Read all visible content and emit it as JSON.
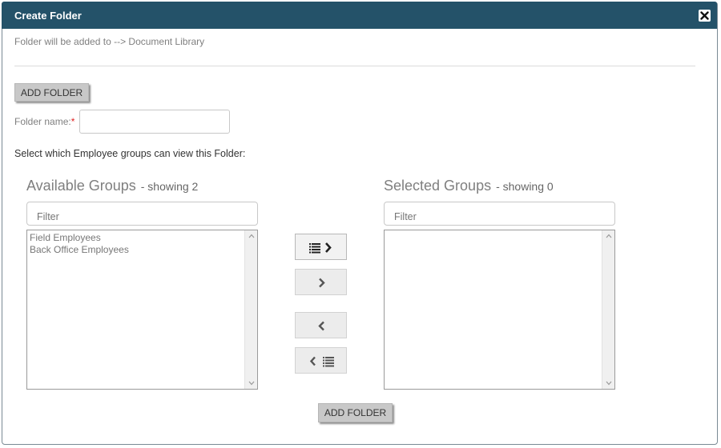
{
  "dialog": {
    "title": "Create Folder",
    "subtitle": "Folder will be added to --> Document Library"
  },
  "icons": {
    "close": "close-icon",
    "move_all_right": "list-chevron-right-icon",
    "move_right": "chevron-right-icon",
    "move_left": "chevron-left-icon",
    "move_all_left": "chevron-left-list-icon"
  },
  "form": {
    "add_folder_top": "ADD FOLDER",
    "folder_name_label": "Folder name:",
    "required_marker": "*",
    "folder_name_value": "",
    "select_prompt": "Select which Employee groups can view this Folder:",
    "add_folder_bottom": "ADD FOLDER"
  },
  "available": {
    "title": "Available Groups",
    "showing": "- showing 2",
    "filter_placeholder": "Filter",
    "items": [
      "Field Employees",
      "Back Office Employees"
    ]
  },
  "selected": {
    "title": "Selected Groups",
    "showing": "- showing 0",
    "filter_placeholder": "Filter",
    "items": []
  },
  "colors": {
    "titlebar": "#245269",
    "button_gray": "#c8c8c8",
    "required": "#e02020"
  }
}
